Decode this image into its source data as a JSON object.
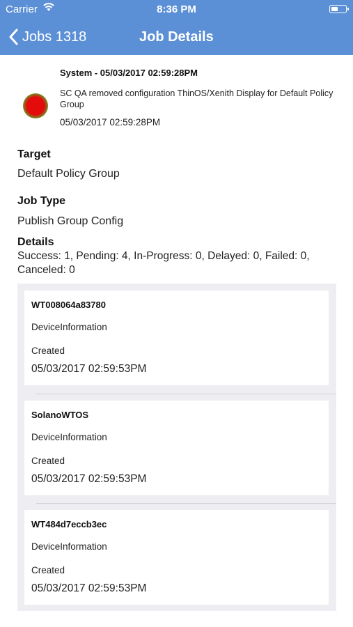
{
  "status_bar": {
    "carrier": "Carrier",
    "time": "8:36 PM"
  },
  "nav": {
    "back_label": "Jobs 1318",
    "title": "Job Details"
  },
  "event": {
    "title": "System - 05/03/2017 02:59:28PM",
    "description": "SC QA removed configuration ThinOS/Xenith Display for Default Policy Group",
    "timestamp": "05/03/2017 02:59:28PM",
    "status_icon": "red-status-dot"
  },
  "target": {
    "label": "Target",
    "value": "Default Policy Group"
  },
  "job_type": {
    "label": "Job Type",
    "value": "Publish Group Config"
  },
  "details": {
    "label": "Details",
    "value": "Success: 1, Pending: 4, In-Progress: 0, Delayed: 0, Failed: 0, Canceled: 0"
  },
  "devices": [
    {
      "name": "WT008064a83780",
      "type": "DeviceInformation",
      "state": "Created",
      "timestamp": "05/03/2017 02:59:53PM"
    },
    {
      "name": "SolanoWTOS",
      "type": "DeviceInformation",
      "state": "Created",
      "timestamp": "05/03/2017 02:59:53PM"
    },
    {
      "name": "WT484d7eccb3ec",
      "type": "DeviceInformation",
      "state": "Created",
      "timestamp": "05/03/2017 02:59:53PM"
    }
  ],
  "colors": {
    "header": "#5b8fd6",
    "list_background": "#ededf2"
  }
}
